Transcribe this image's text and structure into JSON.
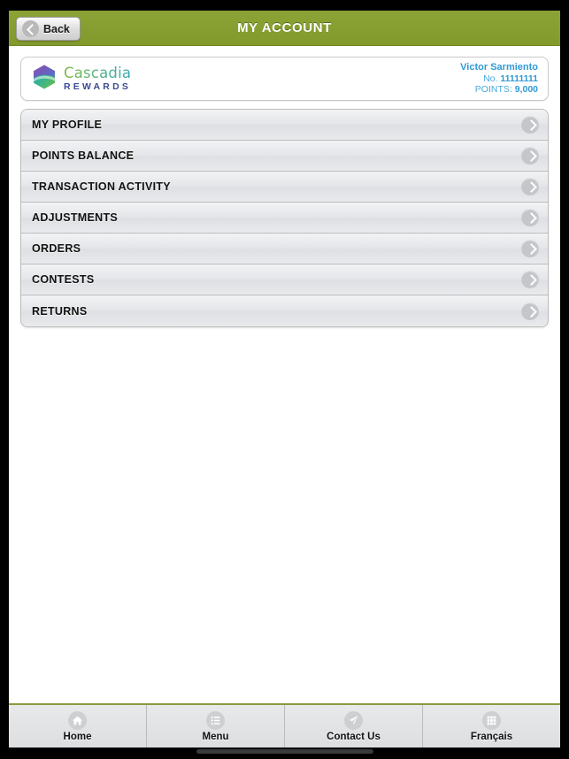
{
  "navbar": {
    "title": "MY ACCOUNT",
    "back_label": "Back",
    "back_icon": "chevron-left-circle-icon",
    "background_color": "#87a02e"
  },
  "account_card": {
    "brand_name": "Cascadia",
    "brand_sub": "REWARDS",
    "logo_icon": "cascadia-hexagon-logo-icon",
    "member_name": "Victor Sarmiento",
    "number_label": "No.",
    "number_value": "11111111",
    "points_label": "POINTS:",
    "points_value": "9,000",
    "text_color": "#2f9ad6"
  },
  "menu": {
    "items": [
      {
        "label": "MY PROFILE",
        "chevron": "chevron-right-circle-icon"
      },
      {
        "label": "POINTS BALANCE",
        "chevron": "chevron-right-circle-icon"
      },
      {
        "label": "TRANSACTION ACTIVITY",
        "chevron": "chevron-right-circle-icon"
      },
      {
        "label": "ADJUSTMENTS",
        "chevron": "chevron-right-circle-icon"
      },
      {
        "label": "ORDERS",
        "chevron": "chevron-right-circle-icon"
      },
      {
        "label": "CONTESTS",
        "chevron": "chevron-right-circle-icon"
      },
      {
        "label": "RETURNS",
        "chevron": "chevron-right-circle-icon"
      }
    ]
  },
  "tabbar": {
    "tabs": [
      {
        "label": "Home",
        "icon": "home-icon"
      },
      {
        "label": "Menu",
        "icon": "list-icon"
      },
      {
        "label": "Contact Us",
        "icon": "paper-plane-icon"
      },
      {
        "label": "Français",
        "icon": "grid-icon"
      }
    ]
  }
}
